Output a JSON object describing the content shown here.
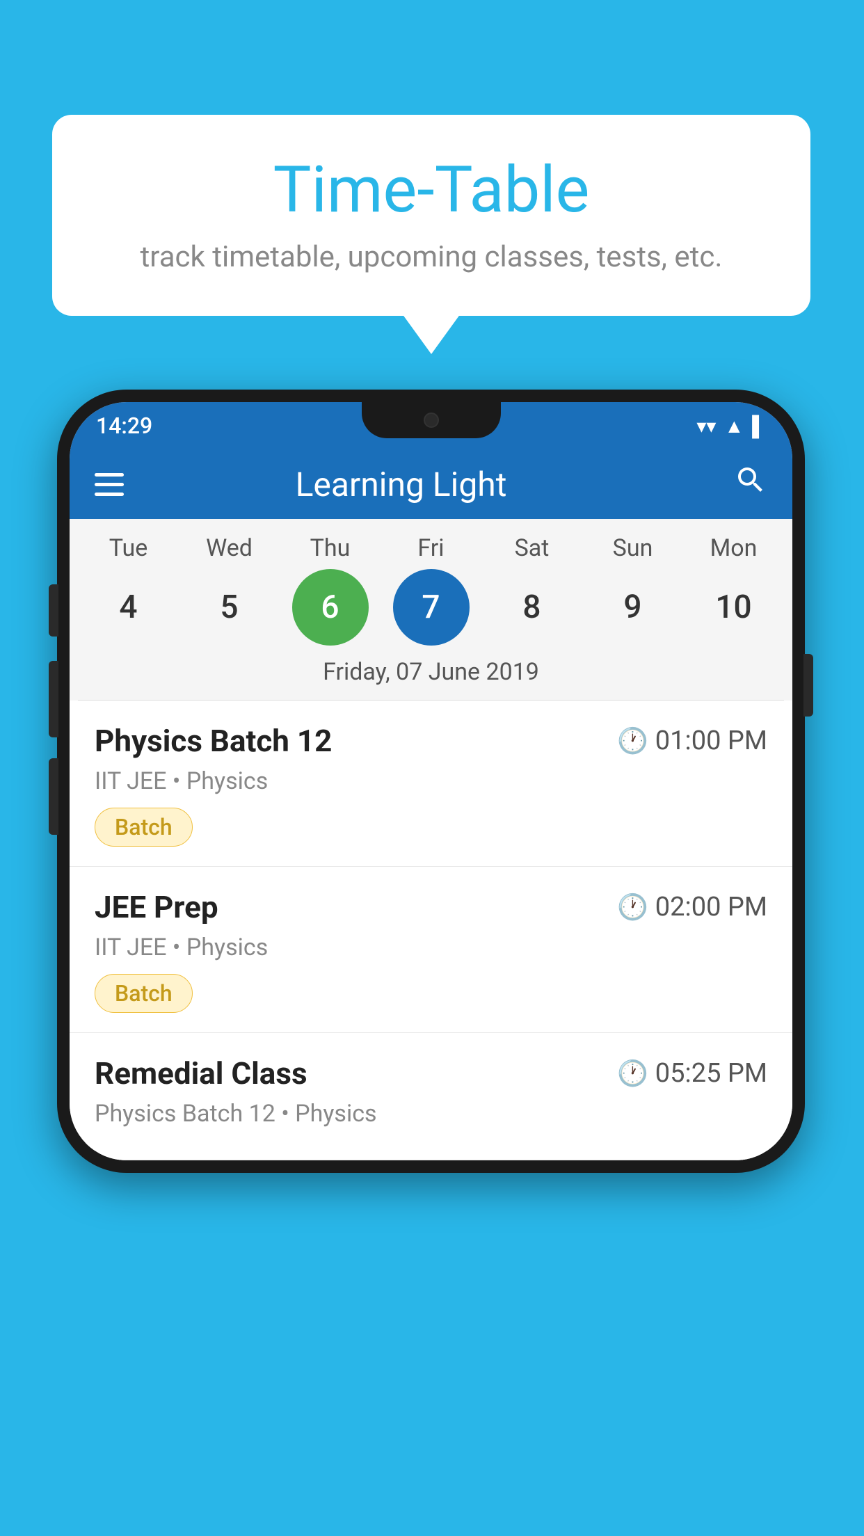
{
  "background_color": "#29b6e8",
  "bubble": {
    "title": "Time-Table",
    "subtitle": "track timetable, upcoming classes, tests, etc."
  },
  "app": {
    "status_bar": {
      "time": "14:29"
    },
    "app_bar": {
      "title": "Learning Light"
    },
    "calendar": {
      "days": [
        {
          "label": "Tue",
          "number": "4"
        },
        {
          "label": "Wed",
          "number": "5"
        },
        {
          "label": "Thu",
          "number": "6",
          "state": "today"
        },
        {
          "label": "Fri",
          "number": "7",
          "state": "selected"
        },
        {
          "label": "Sat",
          "number": "8"
        },
        {
          "label": "Sun",
          "number": "9"
        },
        {
          "label": "Mon",
          "number": "10"
        }
      ],
      "selected_date_label": "Friday, 07 June 2019"
    },
    "schedule": [
      {
        "title": "Physics Batch 12",
        "time": "01:00 PM",
        "subtitle": "IIT JEE • Physics",
        "tag": "Batch"
      },
      {
        "title": "JEE Prep",
        "time": "02:00 PM",
        "subtitle": "IIT JEE • Physics",
        "tag": "Batch"
      },
      {
        "title": "Remedial Class",
        "time": "05:25 PM",
        "subtitle": "Physics Batch 12 • Physics",
        "tag": ""
      }
    ]
  },
  "labels": {
    "menu": "menu",
    "search": "search",
    "clock": "🕐",
    "wifi": "▼",
    "signal": "▲",
    "battery": "▌"
  }
}
